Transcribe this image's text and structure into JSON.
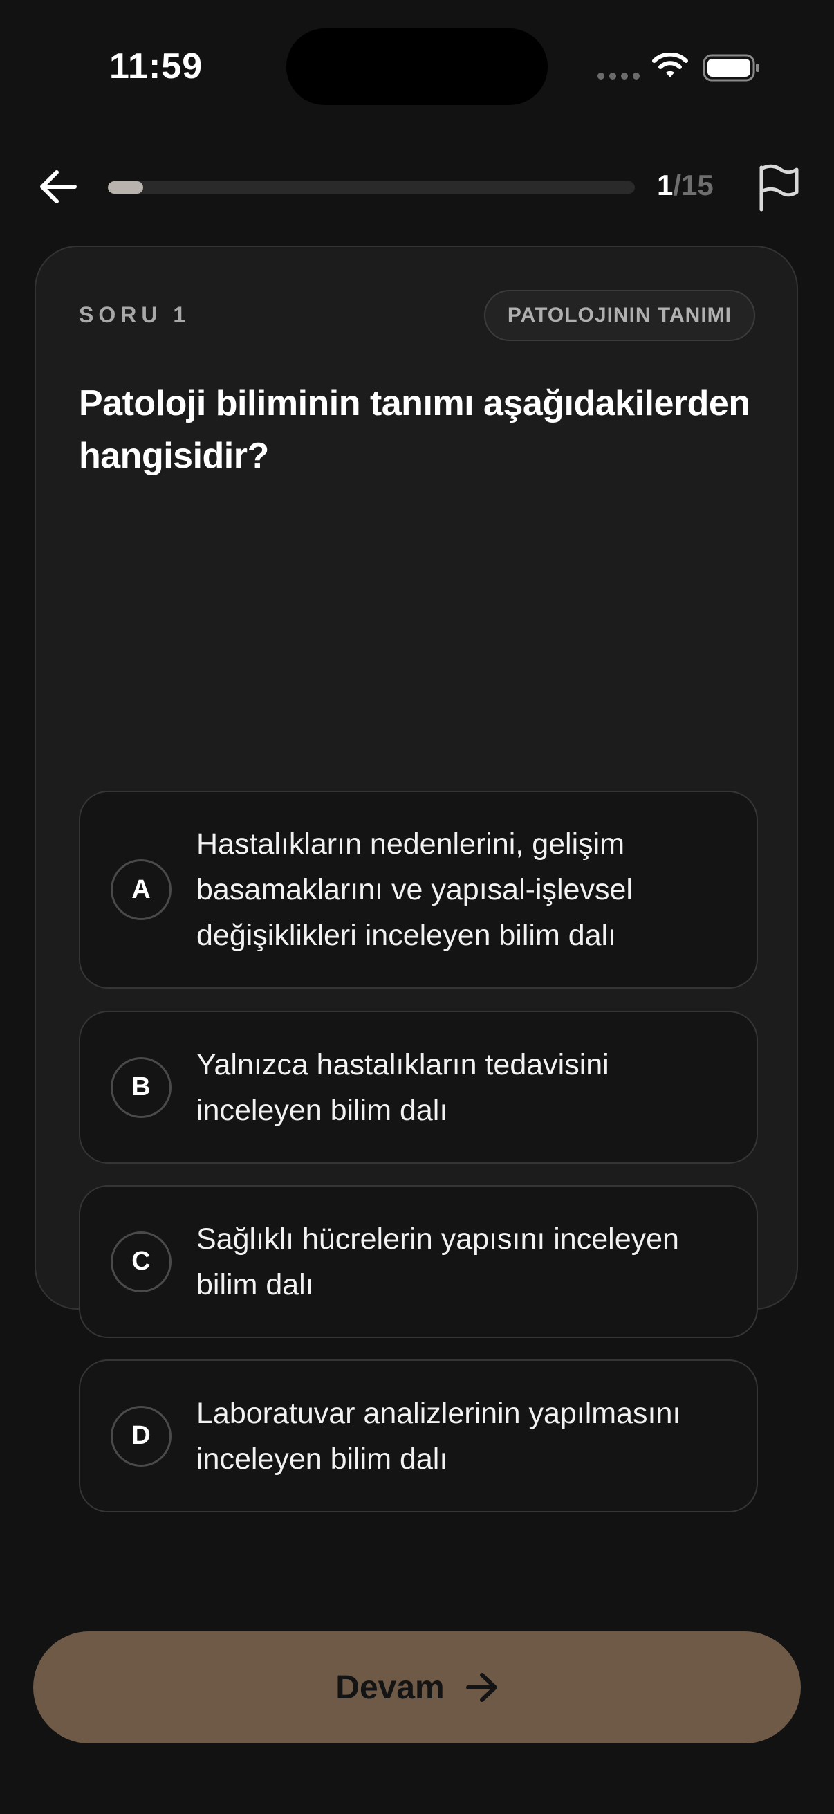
{
  "status_bar": {
    "time": "11:59"
  },
  "nav": {
    "progress_fraction": 0.0667,
    "counter_current": "1",
    "counter_separator": "/",
    "counter_total": "15"
  },
  "question": {
    "number_label": "SORU 1",
    "topic": "PATOLOJININ TANIMI",
    "text": "Patoloji biliminin tanımı aşağıdakilerden hangisidir?",
    "options": [
      {
        "letter": "A",
        "text": "Hastalıkların nedenlerini, gelişim basamaklarını ve yapısal-işlevsel değişiklikleri inceleyen bilim dalı"
      },
      {
        "letter": "B",
        "text": "Yalnızca hastalıkların tedavisini inceleyen bilim dalı"
      },
      {
        "letter": "C",
        "text": "Sağlıklı hücrelerin yapısını inceleyen bilim dalı"
      },
      {
        "letter": "D",
        "text": "Laboratuvar analizlerinin yapılmasını inceleyen bilim dalı"
      }
    ]
  },
  "footer": {
    "continue_label": "Devam"
  },
  "colors": {
    "background": "#121212",
    "card": "#1c1c1c",
    "accent_button": "#6f5a47",
    "progress_fill": "#b8b3ad"
  },
  "icons": {
    "back": "arrow-left-icon",
    "flag": "flag-icon",
    "continue": "arrow-right-icon",
    "wifi": "wifi-icon",
    "battery": "battery-icon"
  }
}
